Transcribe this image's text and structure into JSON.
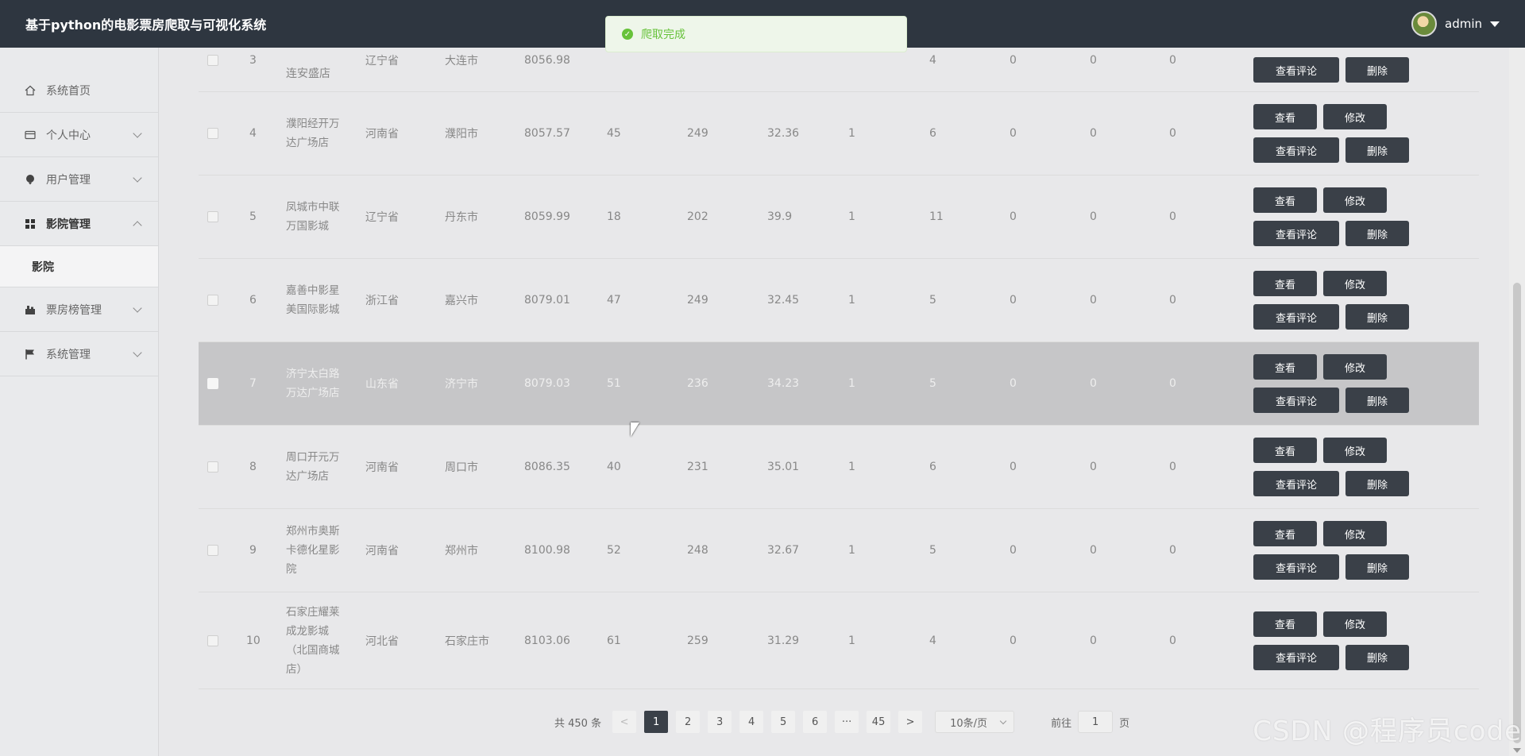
{
  "header": {
    "title": "基于python的电影票房爬取与可视化系统",
    "username": "admin"
  },
  "toast": {
    "message": "爬取完成"
  },
  "sidebar": {
    "items": [
      {
        "label": "系统首页",
        "icon": "home-icon"
      },
      {
        "label": "个人中心",
        "icon": "id-card-icon"
      },
      {
        "label": "用户管理",
        "icon": "user-icon"
      },
      {
        "label": "影院管理",
        "icon": "grid-icon"
      },
      {
        "label": "票房榜管理",
        "icon": "chart-icon"
      },
      {
        "label": "系统管理",
        "icon": "flag-icon"
      }
    ],
    "submenu": {
      "label": "影院"
    }
  },
  "table": {
    "actions": {
      "view": "查看",
      "edit": "修改",
      "comments": "查看评论",
      "delete": "删除"
    },
    "partial_row": {
      "index": "3",
      "name": "连安盛店",
      "province": "辽宁省",
      "city": "大连市",
      "v1": "8056.98",
      "v6": "4",
      "v7": "0",
      "v8": "0",
      "v9": "0"
    },
    "rows": [
      {
        "index": "4",
        "name": "濮阳经开万达广场店",
        "province": "河南省",
        "city": "濮阳市",
        "v1": "8057.57",
        "v2": "45",
        "v3": "249",
        "v4": "32.36",
        "v5": "1",
        "v6": "6",
        "v7": "0",
        "v8": "0",
        "v9": "0"
      },
      {
        "index": "5",
        "name": "凤城市中联万国影城",
        "province": "辽宁省",
        "city": "丹东市",
        "v1": "8059.99",
        "v2": "18",
        "v3": "202",
        "v4": "39.9",
        "v5": "1",
        "v6": "11",
        "v7": "0",
        "v8": "0",
        "v9": "0"
      },
      {
        "index": "6",
        "name": "嘉善中影星美国际影城",
        "province": "浙江省",
        "city": "嘉兴市",
        "v1": "8079.01",
        "v2": "47",
        "v3": "249",
        "v4": "32.45",
        "v5": "1",
        "v6": "5",
        "v7": "0",
        "v8": "0",
        "v9": "0"
      },
      {
        "index": "7",
        "name": "济宁太白路万达广场店",
        "province": "山东省",
        "city": "济宁市",
        "v1": "8079.03",
        "v2": "51",
        "v3": "236",
        "v4": "34.23",
        "v5": "1",
        "v6": "5",
        "v7": "0",
        "v8": "0",
        "v9": "0"
      },
      {
        "index": "8",
        "name": "周口开元万达广场店",
        "province": "河南省",
        "city": "周口市",
        "v1": "8086.35",
        "v2": "40",
        "v3": "231",
        "v4": "35.01",
        "v5": "1",
        "v6": "6",
        "v7": "0",
        "v8": "0",
        "v9": "0"
      },
      {
        "index": "9",
        "name": "郑州市奥斯卡德化星影院",
        "province": "河南省",
        "city": "郑州市",
        "v1": "8100.98",
        "v2": "52",
        "v3": "248",
        "v4": "32.67",
        "v5": "1",
        "v6": "5",
        "v7": "0",
        "v8": "0",
        "v9": "0"
      },
      {
        "index": "10",
        "name": "石家庄耀莱成龙影城（北国商城店）",
        "province": "河北省",
        "city": "石家庄市",
        "v1": "8103.06",
        "v2": "61",
        "v3": "259",
        "v4": "31.29",
        "v5": "1",
        "v6": "4",
        "v7": "0",
        "v8": "0",
        "v9": "0"
      }
    ]
  },
  "pagination": {
    "total": "共 450 条",
    "prev": "<",
    "next": ">",
    "pages": [
      "1",
      "2",
      "3",
      "4",
      "5",
      "6",
      "···",
      "45"
    ],
    "current": "1",
    "page_size": "10条/页",
    "goto_prefix": "前往",
    "goto_value": "1",
    "goto_suffix": "页"
  },
  "watermark": "CSDN @程序员code",
  "colors": {
    "header": "#2e3640",
    "button": "#3a4048",
    "toast_green": "#67c23a"
  }
}
